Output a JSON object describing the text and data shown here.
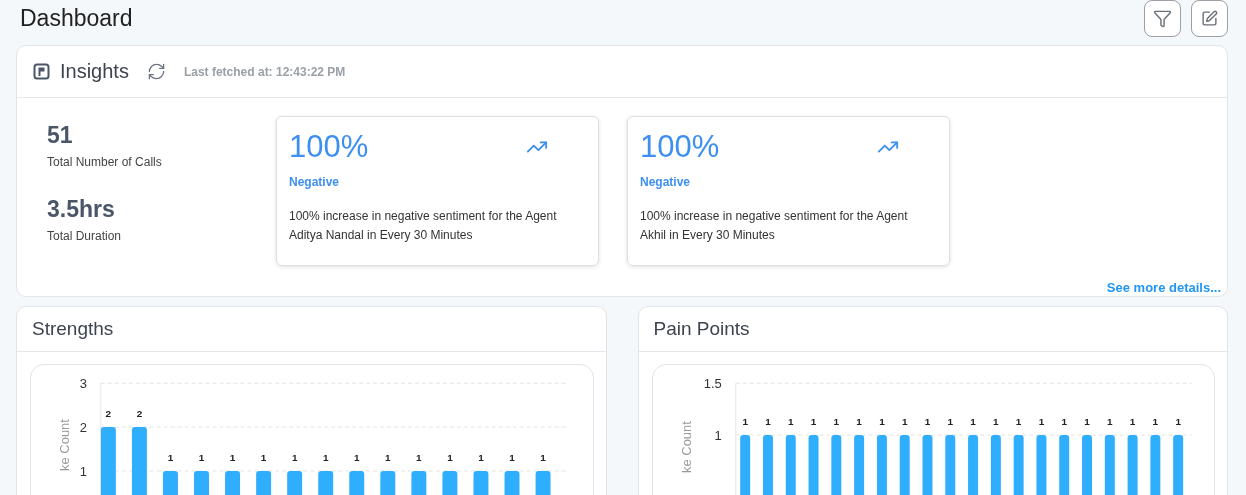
{
  "page": {
    "title": "Dashboard"
  },
  "insights": {
    "title": "Insights",
    "last_fetched": "Last fetched at: 12:43:22 PM",
    "stats": [
      {
        "value": "51",
        "label": "Total Number of Calls"
      },
      {
        "value": "3.5hrs",
        "label": "Total Duration"
      }
    ],
    "cards": [
      {
        "value": "100%",
        "sentiment": "Negative",
        "description": "100% increase in negative sentiment for the Agent Aditya Nandal in Every 30 Minutes"
      },
      {
        "value": "100%",
        "sentiment": "Negative",
        "description": "100% increase in negative sentiment for the Agent Akhil in Every 30 Minutes"
      }
    ],
    "more_link": "See more details..."
  },
  "panels": [
    {
      "title": "Strengths",
      "chart_data": {
        "type": "bar",
        "ylabel": "ke Count",
        "values": [
          2,
          2,
          1,
          1,
          1,
          1,
          1,
          1,
          1,
          1,
          1,
          1,
          1,
          1,
          1
        ],
        "ylim": [
          0,
          3
        ],
        "yticks": [
          1,
          2,
          3
        ],
        "data_labels": true
      }
    },
    {
      "title": "Pain Points",
      "chart_data": {
        "type": "bar",
        "ylabel": "ke Count",
        "values": [
          1,
          1,
          1,
          1,
          1,
          1,
          1,
          1,
          1,
          1,
          1,
          1,
          1,
          1,
          1,
          1,
          1,
          1,
          1,
          1
        ],
        "ylim": [
          0,
          1.5
        ],
        "yticks": [
          1,
          1.5
        ],
        "data_labels": true
      }
    }
  ]
}
